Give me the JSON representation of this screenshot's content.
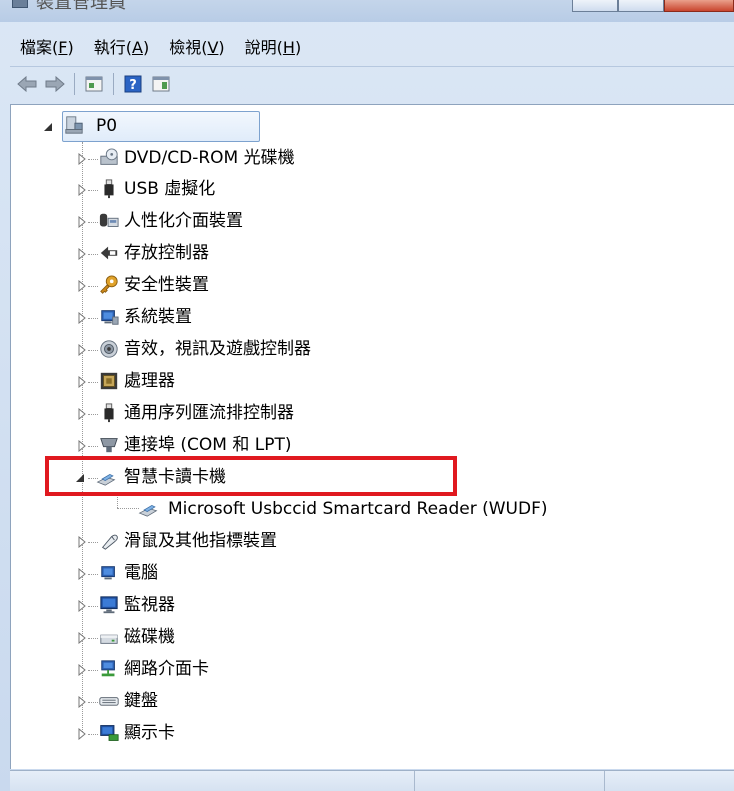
{
  "window": {
    "title": "裝置管理員"
  },
  "menu": [
    {
      "label": "檔案",
      "accel": "(F)",
      "underline": "F"
    },
    {
      "label": "執行",
      "accel": "(A)",
      "underline": "A"
    },
    {
      "label": "檢視",
      "accel": "(V)",
      "underline": "V"
    },
    {
      "label": "說明",
      "accel": "(H)",
      "underline": "H"
    }
  ],
  "toolbar": {
    "buttons": [
      "back-icon",
      "forward-icon",
      "properties-icon",
      "help-icon",
      "view-icon"
    ]
  },
  "tree": {
    "root": {
      "label": "P0",
      "icon": "computer-icon",
      "expanded": true
    },
    "items": [
      {
        "label": "DVD/CD-ROM 光碟機",
        "icon": "dvd-drive-icon",
        "expanded": false
      },
      {
        "label": "USB 虛擬化",
        "icon": "usb-icon",
        "expanded": false
      },
      {
        "label": "人性化介面裝置",
        "icon": "hid-icon",
        "expanded": false
      },
      {
        "label": "存放控制器",
        "icon": "storage-controller-icon",
        "expanded": false
      },
      {
        "label": "安全性裝置",
        "icon": "security-key-icon",
        "expanded": false
      },
      {
        "label": "系統裝置",
        "icon": "system-device-icon",
        "expanded": false
      },
      {
        "label": "音效，視訊及遊戲控制器",
        "icon": "speaker-icon",
        "expanded": false
      },
      {
        "label": "處理器",
        "icon": "processor-icon",
        "expanded": false
      },
      {
        "label": "通用序列匯流排控制器",
        "icon": "usb-controller-icon",
        "expanded": false
      },
      {
        "label": "連接埠 (COM 和 LPT)",
        "icon": "port-icon",
        "expanded": false
      },
      {
        "label": "智慧卡讀卡機",
        "icon": "smartcard-reader-icon",
        "expanded": true,
        "children": [
          {
            "label": "Microsoft Usbccid Smartcard Reader (WUDF)",
            "icon": "smartcard-reader-icon"
          }
        ]
      },
      {
        "label": "滑鼠及其他指標裝置",
        "icon": "mouse-icon",
        "expanded": false
      },
      {
        "label": "電腦",
        "icon": "computer-icon",
        "expanded": false
      },
      {
        "label": "監視器",
        "icon": "monitor-icon",
        "expanded": false
      },
      {
        "label": "磁碟機",
        "icon": "disk-drive-icon",
        "expanded": false
      },
      {
        "label": "網路介面卡",
        "icon": "network-adapter-icon",
        "expanded": false
      },
      {
        "label": "鍵盤",
        "icon": "keyboard-icon",
        "expanded": false
      },
      {
        "label": "顯示卡",
        "icon": "display-adapter-icon",
        "expanded": false
      }
    ]
  },
  "colors": {
    "highlight": "#e0191f",
    "selection": "#e0ecfa"
  }
}
